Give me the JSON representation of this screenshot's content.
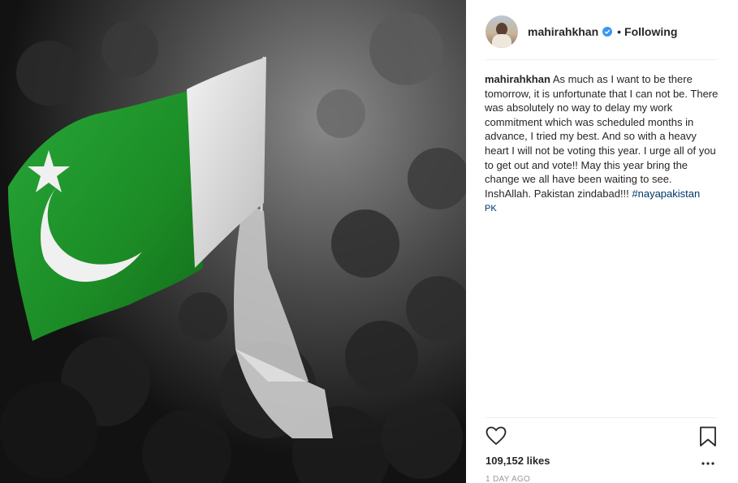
{
  "post": {
    "image_description_icon": "pakistan-flag-crowd-photo"
  },
  "header": {
    "username": "mahirahkhan",
    "separator": "•",
    "follow_status": "Following",
    "verified_icon": "verified-badge-icon",
    "verified_color": "#3897f0"
  },
  "caption": {
    "username": "mahirahkhan",
    "text": "As much as I want to be there tomorrow, it is unfortunate that I can not be. There was absolutely no way to delay my work commitment which was scheduled months in advance, I tried my best. And so with a heavy heart I will not be voting this year. I urge all of you to get out and vote!! May this year bring the change we all have been waiting to see. InshAllah. Pakistan zindabad!!! ",
    "hashtag": "#nayapakistan",
    "hashtag_suffix": "PK",
    "hashtag_color": "#003569"
  },
  "actions": {
    "like_icon": "heart-icon",
    "save_icon": "bookmark-icon",
    "more_icon": "more-options-icon",
    "likes_text": "109,152 likes",
    "timestamp": "1 DAY AGO"
  }
}
